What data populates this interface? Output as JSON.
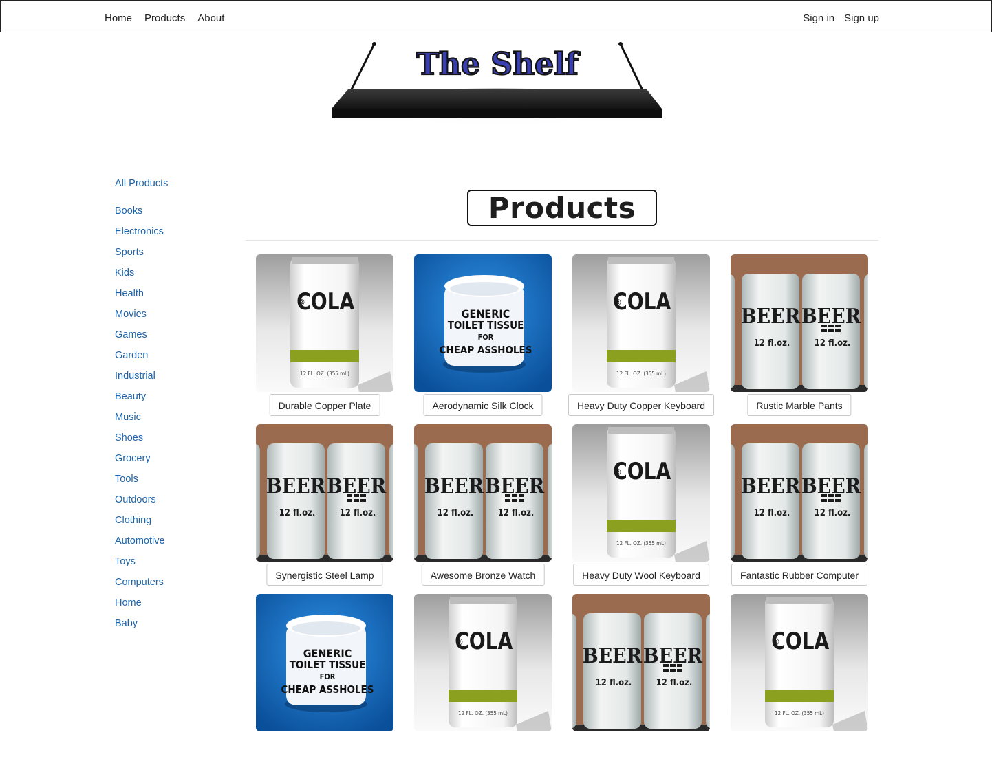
{
  "nav": {
    "home": "Home",
    "products": "Products",
    "about": "About",
    "sign_in": "Sign in",
    "sign_up": "Sign up"
  },
  "logo": {
    "text": "The Shelf",
    "text_color": "#3a3fb0"
  },
  "sidebar": {
    "all_label": "All Products",
    "items": [
      "Books",
      "Electronics",
      "Sports",
      "Kids",
      "Health",
      "Movies",
      "Games",
      "Garden",
      "Industrial",
      "Beauty",
      "Music",
      "Shoes",
      "Grocery",
      "Tools",
      "Outdoors",
      "Clothing",
      "Automotive",
      "Toys",
      "Computers",
      "Home",
      "Baby"
    ]
  },
  "main": {
    "title": "Products"
  },
  "products": [
    {
      "name": "Durable Copper Plate",
      "image": "cola-can"
    },
    {
      "name": "Aerodynamic Silk Clock",
      "image": "toilet-tissue"
    },
    {
      "name": "Heavy Duty Copper Keyboard",
      "image": "cola-can"
    },
    {
      "name": "Rustic Marble Pants",
      "image": "beer-cans"
    },
    {
      "name": "Synergistic Steel Lamp",
      "image": "beer-cans"
    },
    {
      "name": "Awesome Bronze Watch",
      "image": "beer-cans"
    },
    {
      "name": "Heavy Duty Wool Keyboard",
      "image": "cola-can"
    },
    {
      "name": "Fantastic Rubber Computer",
      "image": "beer-cans"
    },
    {
      "name": "",
      "image": "toilet-tissue"
    },
    {
      "name": "",
      "image": "cola-can"
    },
    {
      "name": "",
      "image": "beer-cans"
    },
    {
      "name": "",
      "image": "cola-can"
    }
  ],
  "images": {
    "cola": {
      "label": "COLA",
      "symbol": "®",
      "volume": "12 FL. OZ. (355 mL)"
    },
    "tissue": {
      "lines": [
        "GENERIC",
        "TOILET TISSUE",
        "FOR",
        "CHEAP ASSHOLES"
      ]
    },
    "beer": {
      "label": "BEER",
      "volume": "12 fl.oz."
    }
  },
  "colors": {
    "link": "#1f64a8",
    "nav_text": "#222222",
    "tissue_bg": "#0b6fc4",
    "beer_wall": "#9a6b4e",
    "cola_stripe": "#8aa01e"
  }
}
